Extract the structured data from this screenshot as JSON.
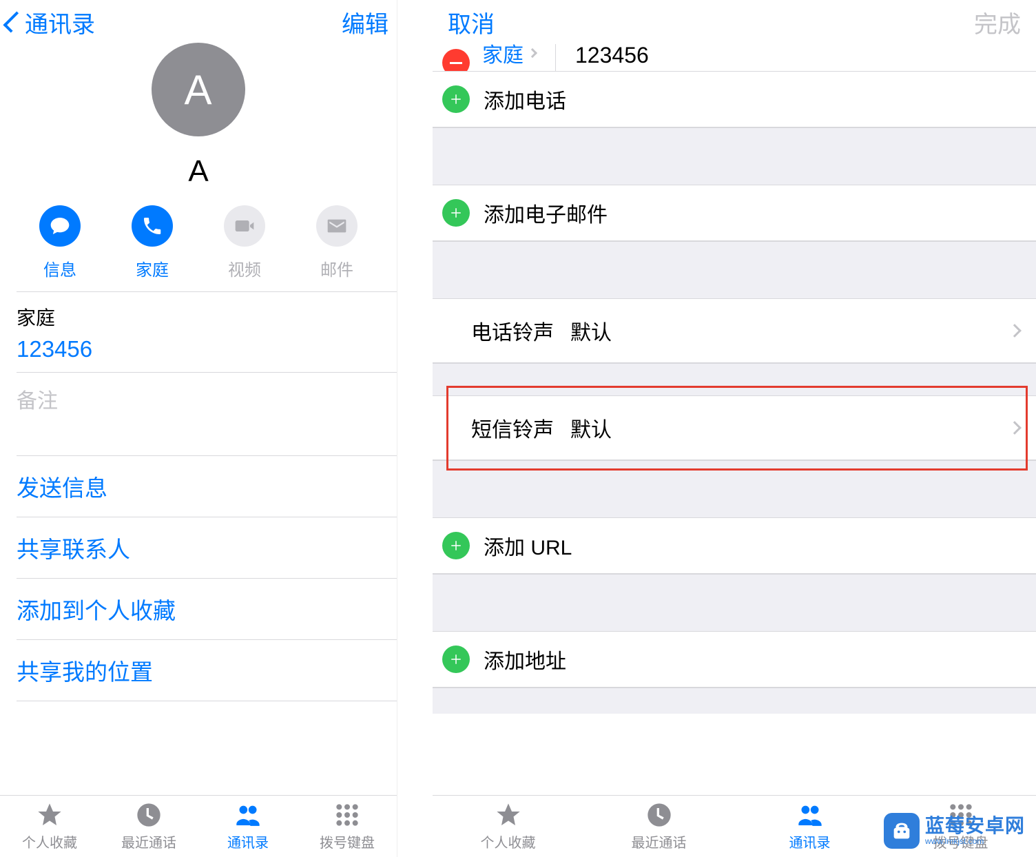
{
  "colors": {
    "accent": "#007aff",
    "green": "#34c759",
    "red": "#ff3b30",
    "gray": "#8e8e93"
  },
  "left": {
    "back_label": "通讯录",
    "edit_label": "编辑",
    "avatar_initial": "A",
    "contact_name": "A",
    "actions": {
      "message": "信息",
      "home": "家庭",
      "video": "视频",
      "mail": "邮件"
    },
    "phone": {
      "label": "家庭",
      "number": "123456"
    },
    "notes_placeholder": "备注",
    "links": {
      "send_message": "发送信息",
      "share_contact": "共享联系人",
      "add_favorite": "添加到个人收藏",
      "share_location": "共享我的位置"
    }
  },
  "right": {
    "cancel": "取消",
    "done": "完成",
    "partial_row": {
      "label": "家庭",
      "number": "123456"
    },
    "add_phone": "添加电话",
    "add_email": "添加电子邮件",
    "ringtone": {
      "label": "电话铃声",
      "value": "默认"
    },
    "texttone": {
      "label": "短信铃声",
      "value": "默认"
    },
    "add_url": "添加 URL",
    "add_address": "添加地址"
  },
  "tabs": {
    "favorites": "个人收藏",
    "recents": "最近通话",
    "contacts": "通讯录",
    "keypad": "拨号键盘"
  },
  "watermark": {
    "name": "蓝莓安卓网",
    "url": "www.lmkjst.com"
  }
}
